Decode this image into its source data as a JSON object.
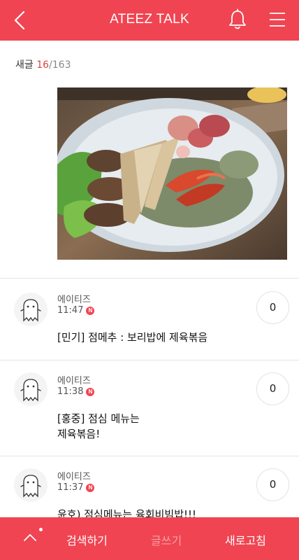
{
  "header": {
    "title": "ATEEZ TALK",
    "back_icon": "chevron-left-icon",
    "bell_icon": "bell-icon",
    "menu_icon": "hamburger-menu-icon"
  },
  "new_posts": {
    "label": "새글",
    "current": "16",
    "total": "/163"
  },
  "posts": [
    {
      "author": "에이티즈",
      "time": "11:47",
      "badge": "N",
      "likes": "0",
      "lines": [
        "[민기] 점메추 : 보리밥에 제육볶음"
      ]
    },
    {
      "author": "에이티즈",
      "time": "11:38",
      "badge": "N",
      "likes": "0",
      "lines": [
        "[홍중] 점심 메뉴는",
        "제육볶음!"
      ]
    },
    {
      "author": "에이티즈",
      "time": "11:37",
      "badge": "N",
      "likes": "0",
      "lines": [
        "윤호) 점심메뉴는 육회비빔밥!!!"
      ]
    }
  ],
  "bottom_bar": {
    "up_icon": "chevron-up-icon",
    "search_label": "검색하기",
    "write_label": "글쓰기",
    "refresh_label": "새로고침"
  },
  "colors": {
    "accent": "#f04452",
    "count_highlight": "#d8483f"
  }
}
